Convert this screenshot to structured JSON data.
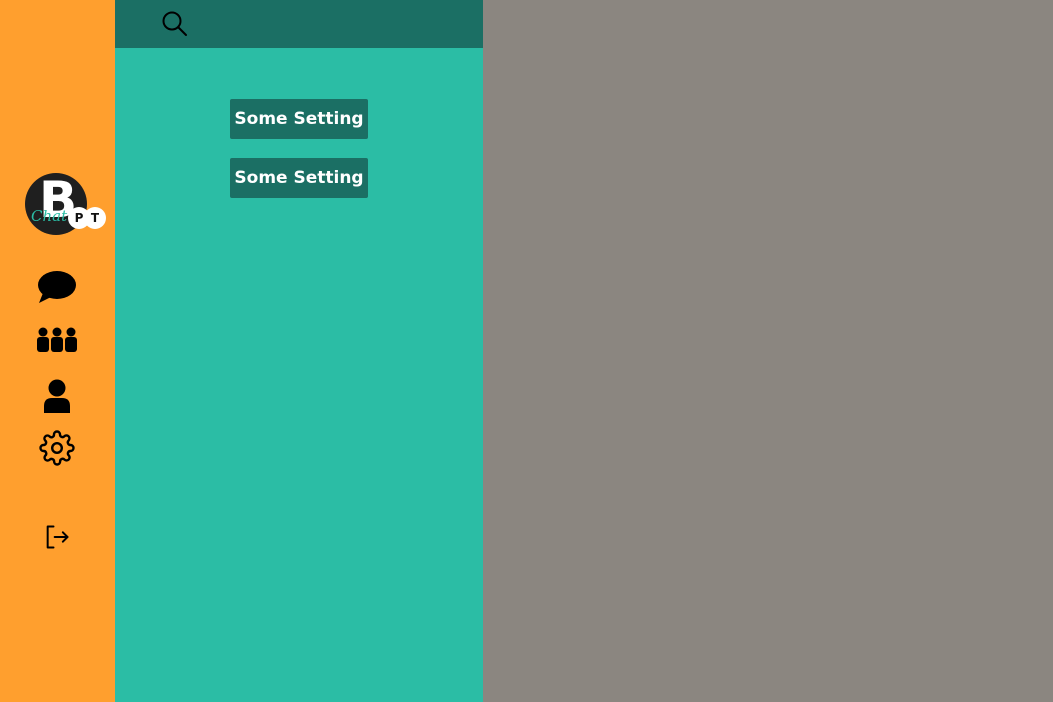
{
  "logo": {
    "letter": "B",
    "script": "Chat",
    "badges": [
      "P",
      "T"
    ]
  },
  "sidebar": {
    "icons": [
      {
        "name": "chat-bubble-icon"
      },
      {
        "name": "groups-icon"
      },
      {
        "name": "user-icon"
      },
      {
        "name": "gear-icon"
      },
      {
        "name": "logout-icon"
      }
    ]
  },
  "panel": {
    "search_icon": "search-icon",
    "buttons": [
      {
        "label": "Some Setting"
      },
      {
        "label": "Some Setting"
      }
    ]
  },
  "colors": {
    "rail": "#ff9f2e",
    "panel": "#2bbda5",
    "panel_header": "#1b6f64",
    "button": "#1b6f64",
    "content": "#8b8680"
  }
}
